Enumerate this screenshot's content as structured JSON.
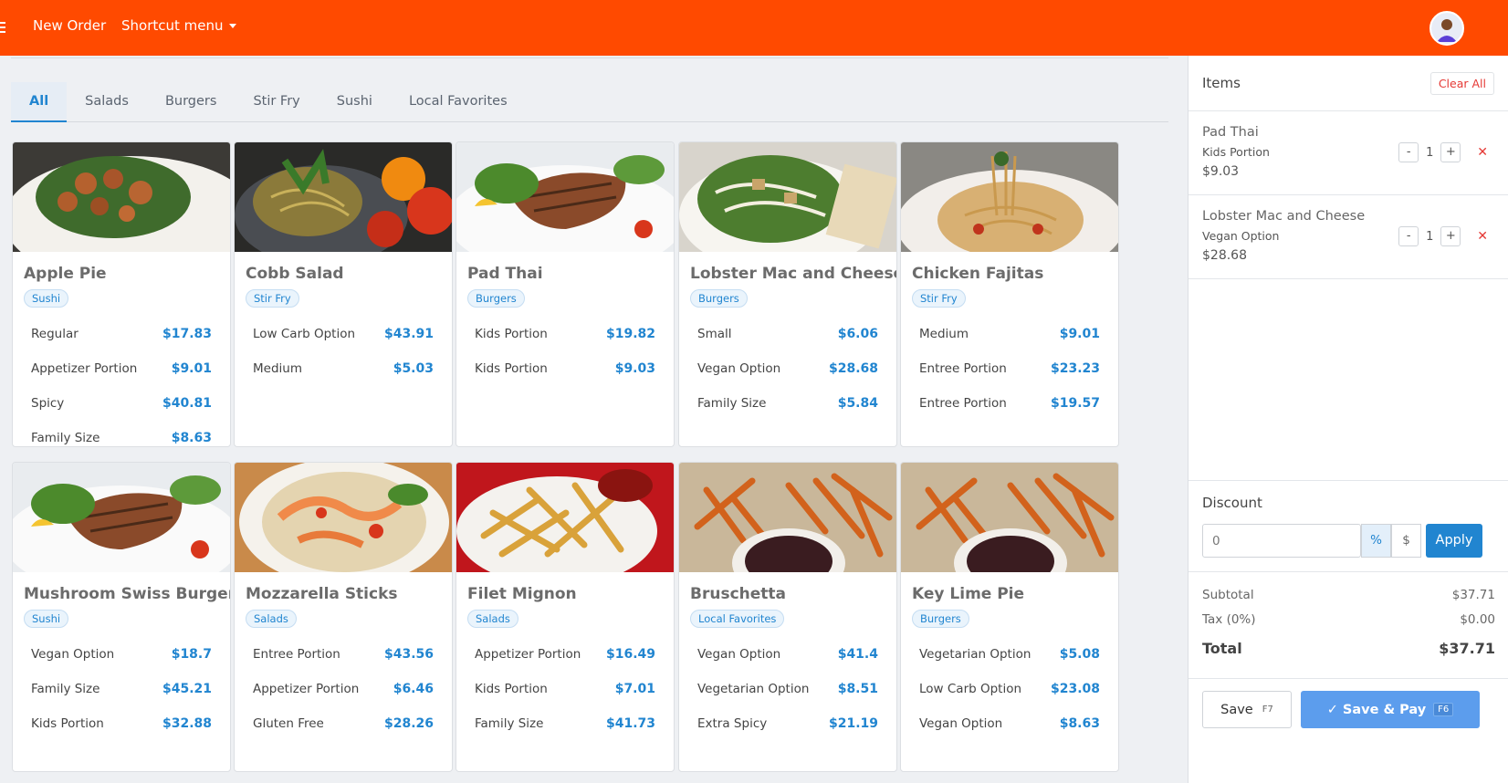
{
  "header": {
    "new_order": "New Order",
    "shortcut_menu": "Shortcut menu"
  },
  "tabs": [
    "All",
    "Salads",
    "Burgers",
    "Stir Fry",
    "Sushi",
    "Local Favorites"
  ],
  "products": [
    {
      "title": "Apple Pie",
      "tag": "Sushi",
      "img": "chicken-salad",
      "options": [
        {
          "name": "Regular",
          "price": "$17.83"
        },
        {
          "name": "Appetizer Portion",
          "price": "$9.01"
        },
        {
          "name": "Spicy",
          "price": "$40.81"
        },
        {
          "name": "Family Size",
          "price": "$8.63"
        }
      ]
    },
    {
      "title": "Cobb Salad",
      "tag": "Stir Fry",
      "img": "noodles-tomatoes",
      "options": [
        {
          "name": "Low Carb Option",
          "price": "$43.91"
        },
        {
          "name": "Medium",
          "price": "$5.03"
        }
      ]
    },
    {
      "title": "Pad Thai",
      "tag": "Burgers",
      "img": "grilled-salmon",
      "options": [
        {
          "name": "Kids Portion",
          "price": "$19.82"
        },
        {
          "name": "Kids Portion",
          "price": "$9.03"
        }
      ]
    },
    {
      "title": "Lobster Mac and Cheese",
      "tag": "Burgers",
      "img": "caesar-salad",
      "options": [
        {
          "name": "Small",
          "price": "$6.06"
        },
        {
          "name": "Vegan Option",
          "price": "$28.68"
        },
        {
          "name": "Family Size",
          "price": "$5.84"
        }
      ]
    },
    {
      "title": "Chicken Fajitas",
      "tag": "Stir Fry",
      "img": "spaghetti",
      "options": [
        {
          "name": "Medium",
          "price": "$9.01"
        },
        {
          "name": "Entree Portion",
          "price": "$23.23"
        },
        {
          "name": "Entree Portion",
          "price": "$19.57"
        }
      ]
    },
    {
      "title": "Mushroom Swiss Burger",
      "tag": "Sushi",
      "img": "grilled-salmon",
      "options": [
        {
          "name": "Vegan Option",
          "price": "$18.7"
        },
        {
          "name": "Family Size",
          "price": "$45.21"
        },
        {
          "name": "Kids Portion",
          "price": "$32.88"
        }
      ]
    },
    {
      "title": "Mozzarella Sticks",
      "tag": "Salads",
      "img": "shrimp-noodles",
      "options": [
        {
          "name": "Entree Portion",
          "price": "$43.56"
        },
        {
          "name": "Appetizer Portion",
          "price": "$6.46"
        },
        {
          "name": "Gluten Free",
          "price": "$28.26"
        }
      ]
    },
    {
      "title": "Filet Mignon",
      "tag": "Salads",
      "img": "fries",
      "options": [
        {
          "name": "Appetizer Portion",
          "price": "$16.49"
        },
        {
          "name": "Kids Portion",
          "price": "$7.01"
        },
        {
          "name": "Family Size",
          "price": "$41.73"
        }
      ]
    },
    {
      "title": "Bruschetta",
      "tag": "Local Favorites",
      "img": "sweet-potato-fries",
      "options": [
        {
          "name": "Vegan Option",
          "price": "$41.4"
        },
        {
          "name": "Vegetarian Option",
          "price": "$8.51"
        },
        {
          "name": "Extra Spicy",
          "price": "$21.19"
        }
      ]
    },
    {
      "title": "Key Lime Pie",
      "tag": "Burgers",
      "img": "sweet-potato-fries",
      "options": [
        {
          "name": "Vegetarian Option",
          "price": "$5.08"
        },
        {
          "name": "Low Carb Option",
          "price": "$23.08"
        },
        {
          "name": "Vegan Option",
          "price": "$8.63"
        }
      ]
    }
  ],
  "cart": {
    "title": "Items",
    "clear_all": "Clear All",
    "items": [
      {
        "name": "Pad Thai",
        "option": "Kids Portion",
        "price": "$9.03",
        "qty": "1"
      },
      {
        "name": "Lobster Mac and Cheese",
        "option": "Vegan Option",
        "price": "$28.68",
        "qty": "1"
      }
    ],
    "discount_label": "Discount",
    "discount_value": "0",
    "percent": "%",
    "dollar": "$",
    "apply": "Apply",
    "subtotal_label": "Subtotal",
    "subtotal": "$37.71",
    "tax_label": "Tax (0%)",
    "tax": "$0.00",
    "total_label": "Total",
    "total": "$37.71",
    "save": "Save",
    "save_key": "F7",
    "save_pay": "✓ Save & Pay",
    "save_pay_key": "F6"
  },
  "colors": {
    "brand": "#ff4a00",
    "accent": "#2185d0",
    "danger": "#e53935"
  }
}
